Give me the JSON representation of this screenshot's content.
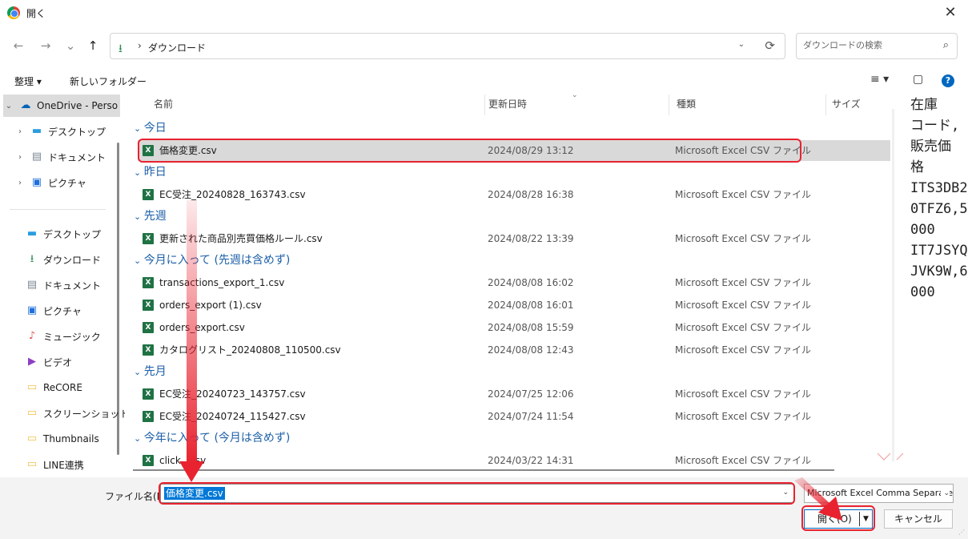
{
  "window": {
    "title": "開く",
    "close_label": "✕"
  },
  "nav": {
    "back": "←",
    "forward": "→",
    "recent": "⌄",
    "up": "↑",
    "path_icon": "download-icon",
    "breadcrumb": "ダウンロード",
    "refresh": "⟳",
    "search_placeholder": "ダウンロードの検索"
  },
  "toolbar": {
    "organize": "整理 ▾",
    "new_folder": "新しいフォルダー",
    "view": "≡ ▾",
    "pane": "▢",
    "help": "?"
  },
  "sidebar": {
    "items": [
      {
        "label": "OneDrive - Perso",
        "icon": "cloud-icon",
        "expand": "⌄",
        "color": "#0364b8"
      },
      {
        "label": "デスクトップ",
        "icon": "desktop-icon",
        "expand": "›",
        "color": "#2b9de0"
      },
      {
        "label": "ドキュメント",
        "icon": "document-icon",
        "expand": "›",
        "color": "#7b8794"
      },
      {
        "label": "ピクチャ",
        "icon": "picture-icon",
        "expand": "›",
        "color": "#1e6fd9"
      },
      {
        "label": "デスクトップ",
        "icon": "desktop-icon",
        "color": "#2b9de0"
      },
      {
        "label": "ダウンロード",
        "icon": "download-icon",
        "color": "#2e8b57"
      },
      {
        "label": "ドキュメント",
        "icon": "document-icon",
        "color": "#7b8794"
      },
      {
        "label": "ピクチャ",
        "icon": "picture-icon",
        "color": "#1e6fd9"
      },
      {
        "label": "ミュージック",
        "icon": "music-icon",
        "color": "#e0584f"
      },
      {
        "label": "ビデオ",
        "icon": "video-icon",
        "color": "#8b3fc4"
      },
      {
        "label": "ReCORE",
        "icon": "folder-icon",
        "color": "#f2c14e"
      },
      {
        "label": "スクリーンショット",
        "icon": "folder-icon",
        "color": "#f2c14e"
      },
      {
        "label": "Thumbnails",
        "icon": "folder-icon",
        "color": "#f2c14e"
      },
      {
        "label": "LINE連携",
        "icon": "folder-icon",
        "color": "#f2c14e"
      }
    ],
    "pin": "📌"
  },
  "columns": {
    "name": "名前",
    "modified": "更新日時",
    "type": "種類",
    "size": "サイズ"
  },
  "groups": [
    {
      "label": "今日",
      "files": [
        {
          "name": "価格変更.csv",
          "date": "2024/08/29 13:12",
          "type": "Microsoft Excel CSV ファイル",
          "selected": true
        }
      ]
    },
    {
      "label": "昨日",
      "files": [
        {
          "name": "EC受注_20240828_163743.csv",
          "date": "2024/08/28 16:38",
          "type": "Microsoft Excel CSV ファイル"
        }
      ]
    },
    {
      "label": "先週",
      "files": [
        {
          "name": "更新された商品別売買価格ルール.csv",
          "date": "2024/08/22 13:39",
          "type": "Microsoft Excel CSV ファイル"
        }
      ]
    },
    {
      "label": "今月に入って (先週は含めず)",
      "files": [
        {
          "name": "transactions_export_1.csv",
          "date": "2024/08/08 16:02",
          "type": "Microsoft Excel CSV ファイル"
        },
        {
          "name": "orders_export (1).csv",
          "date": "2024/08/08 16:01",
          "type": "Microsoft Excel CSV ファイル"
        },
        {
          "name": "orders_export.csv",
          "date": "2024/08/08 15:59",
          "type": "Microsoft Excel CSV ファイル"
        },
        {
          "name": "カタログリスト_20240808_110500.csv",
          "date": "2024/08/08 12:43",
          "type": "Microsoft Excel CSV ファイル"
        }
      ]
    },
    {
      "label": "先月",
      "files": [
        {
          "name": "EC受注_20240723_143757.csv",
          "date": "2024/07/25 12:06",
          "type": "Microsoft Excel CSV ファイル"
        },
        {
          "name": "EC受注_20240724_115427.csv",
          "date": "2024/07/24 11:54",
          "type": "Microsoft Excel CSV ファイル"
        }
      ]
    },
    {
      "label": "今年に入って (今月は含めず)",
      "files": [
        {
          "name": "click...csv",
          "date": "2024/03/22 14:31",
          "type": "Microsoft Excel CSV ファイル"
        }
      ]
    }
  ],
  "preview_text": "在庫\nコード,\n販売価\n格\nITS3DB2\n0TFZ6,5\n000\nIT7JSYQ\nJVK9W,6\n000",
  "footer": {
    "filename_label": "ファイル名(N):",
    "filename_value": "価格変更.csv",
    "filetype": "Microsoft Excel Comma Separated",
    "open_label": "開く(O)",
    "cancel_label": "キャンセル"
  },
  "colors": {
    "accent": "#0067c0",
    "callout": "#e8232f",
    "group_header": "#1c5fa8",
    "excel": "#1f7244"
  }
}
